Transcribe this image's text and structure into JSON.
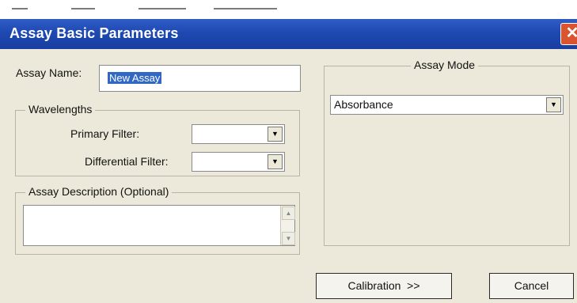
{
  "window": {
    "title": "Assay Basic Parameters",
    "close_glyph": "✕"
  },
  "assay_name": {
    "label": "Assay Name:",
    "value": "New Assay"
  },
  "wavelengths": {
    "legend": "Wavelengths",
    "primary_filter_label": "Primary Filter:",
    "primary_filter_value": "",
    "differential_filter_label": "Differential Filter:",
    "differential_filter_value": ""
  },
  "assay_description": {
    "legend": "Assay Description (Optional)",
    "value": ""
  },
  "assay_mode": {
    "legend": "Assay Mode",
    "selected": "Absorbance"
  },
  "buttons": {
    "calibration": "Calibration  >>",
    "cancel": "Cancel"
  },
  "colors": {
    "titlebar": "#1f49b2",
    "dialog_bg": "#ede9da",
    "selection": "#3168c4",
    "close_button": "#d9542f"
  }
}
